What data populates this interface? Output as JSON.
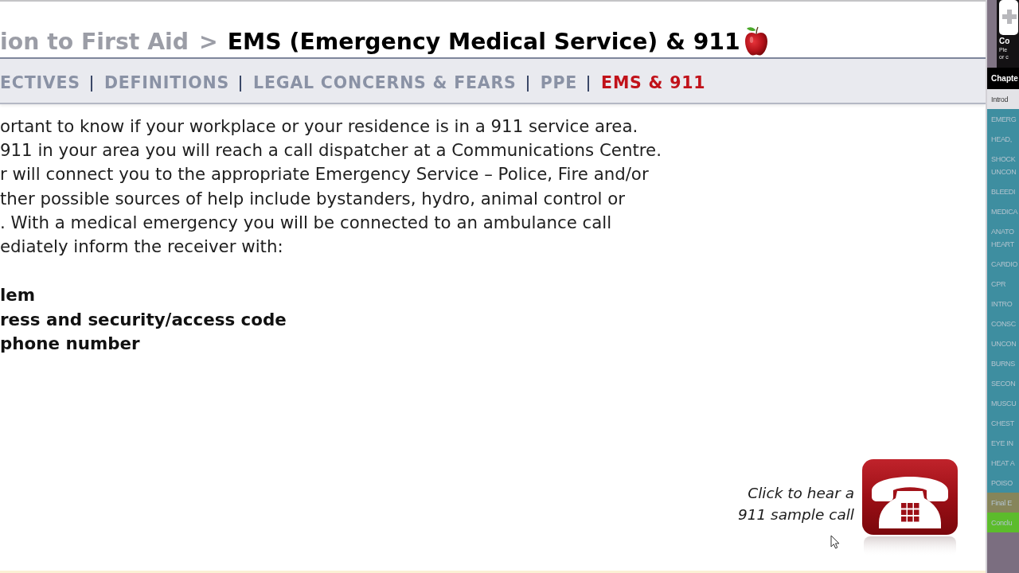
{
  "breadcrumb": {
    "parent": "ion to First Aid",
    "separator": ">",
    "title": "EMS (Emergency Medical Service) & 911"
  },
  "nav_tabs": [
    {
      "label": "ECTIVES",
      "selected": false
    },
    {
      "label": "DEFINITIONS",
      "selected": false
    },
    {
      "label": "LEGAL CONCERNS & FEARS",
      "selected": false
    },
    {
      "label": "PPE",
      "selected": false
    },
    {
      "label": "EMS & 911",
      "selected": true
    }
  ],
  "body": {
    "lines": [
      "ortant to know if your workplace or your residence is in a 911 service area.",
      "911 in your area you will reach a call dispatcher at a Communications Centre.",
      "r will connect you to the appropriate Emergency Service – Police, Fire and/or",
      "ther possible sources of help include bystanders, hydro, animal control or",
      ". With a medical emergency you will be connected to an ambulance call",
      "ediately inform the receiver with:"
    ],
    "info_items": [
      "lem",
      "ress and security/access code",
      "phone number"
    ]
  },
  "sample_call": {
    "caption": "Click to hear a 911 sample call"
  },
  "sidebar": {
    "logo_title": "Co",
    "logo_lines": [
      "Ple",
      "or c"
    ],
    "header": "Chapte",
    "items": [
      {
        "label": "Introd",
        "selected": true
      },
      {
        "label": "EMERG",
        "selected": false,
        "color": "#3e8ea0"
      },
      {
        "label": "HEAD,",
        "selected": false,
        "color": "#3e8ea0"
      },
      {
        "label": "SHOCK UNCON",
        "selected": false,
        "color": "#3e8ea0"
      },
      {
        "label": "BLEEDI",
        "selected": false,
        "color": "#3e8ea0"
      },
      {
        "label": "MEDICA",
        "selected": false,
        "color": "#3e8ea0"
      },
      {
        "label": "ANATO HEART",
        "selected": false,
        "color": "#3e8ea0"
      },
      {
        "label": "CARDIO",
        "selected": false,
        "color": "#3e8ea0"
      },
      {
        "label": "CPR",
        "selected": false,
        "color": "#3e8ea0"
      },
      {
        "label": "INTRO",
        "selected": false,
        "color": "#3e8ea0"
      },
      {
        "label": "CONSC",
        "selected": false,
        "color": "#3e8ea0"
      },
      {
        "label": "UNCON",
        "selected": false,
        "color": "#3e8ea0"
      },
      {
        "label": "BURNS",
        "selected": false,
        "color": "#3e8ea0"
      },
      {
        "label": "SECON",
        "selected": false,
        "color": "#3e8ea0"
      },
      {
        "label": "MUSCU",
        "selected": false,
        "color": "#3e8ea0"
      },
      {
        "label": "CHEST",
        "selected": false,
        "color": "#3e8ea0"
      },
      {
        "label": "EYE IN",
        "selected": false,
        "color": "#3e8ea0"
      },
      {
        "label": "HEAT A",
        "selected": false,
        "color": "#3e8ea0"
      },
      {
        "label": "POISO",
        "selected": false,
        "color": "#3e8ea0"
      },
      {
        "label": "Final E",
        "selected": false,
        "color": "#86855a"
      },
      {
        "label": "Conclu",
        "selected": false,
        "color": "#5cbc2c"
      }
    ]
  }
}
